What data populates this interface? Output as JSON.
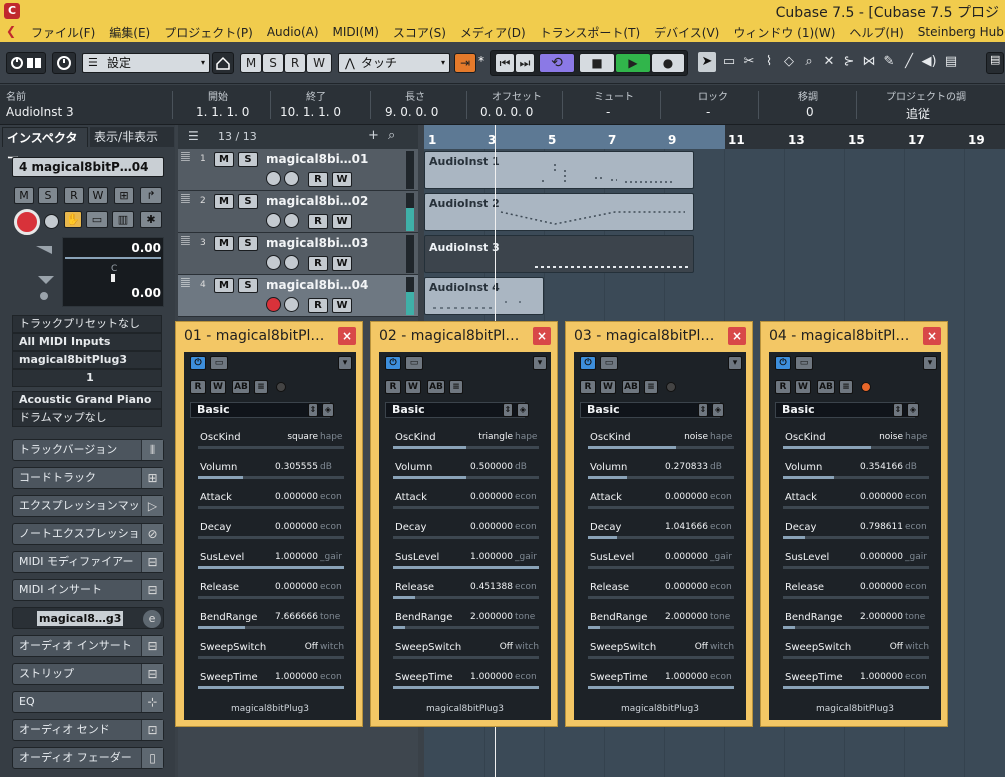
{
  "window": {
    "title": "Cubase 7.5 - [Cubase 7.5 プロジ",
    "app_icon": "cubase-logo-icon"
  },
  "menu": {
    "edit_icon": "e",
    "items": [
      "ファイル(F)",
      "編集(E)",
      "プロジェクト(P)",
      "Audio(A)",
      "MIDI(M)",
      "スコア(S)",
      "メディア(D)",
      "トランスポート(T)",
      "デバイス(V)",
      "ウィンドウ (1)(W)",
      "ヘルプ(H)",
      "Steinberg Hub(I)"
    ]
  },
  "toolbar": {
    "preset_label": "設定",
    "m": "M",
    "s": "S",
    "r": "R",
    "w": "W",
    "automation_mode": "タッチ",
    "auto_star": "*",
    "play_color": "#31b54b",
    "cycle_color": "#8b79e6"
  },
  "infoline": {
    "headers": {
      "name": "名前",
      "start": "開始",
      "end": "終了",
      "length": "長さ",
      "offset": "オフセット",
      "mute": "ミュート",
      "lock": "ロック",
      "transpose": "移調",
      "project_follow": "プロジェクトの調"
    },
    "values": {
      "name": "AudioInst",
      "name_num": "3",
      "start": "1.  1.  1.    0",
      "end": "10.  1.  1.    0",
      "length": "9.  0.  0.    0",
      "offset": "0.  0.  0.    0",
      "mute": "-",
      "lock": "-",
      "transpose": "0",
      "project_follow": "追従"
    }
  },
  "inspector": {
    "tab_inspector": "インスペクター",
    "tab_visibility": "表示/非表示",
    "track_num": "4",
    "track_name": "magical8bitP…04",
    "btn_m": "M",
    "btn_s": "S",
    "btn_r": "R",
    "btn_w": "W",
    "volume": "0.00",
    "pan_label": "C",
    "delay": "0.00",
    "preset": "トラックプリセットなし",
    "input": "All MIDI Inputs",
    "output": "magical8bitPlug3",
    "channel": "1",
    "program": "Acoustic Grand Piano",
    "drum_map": "ドラムマップなし",
    "sections": [
      "トラックバージョン",
      "コードトラック",
      "エクスプレッションマップ",
      "ノートエクスプレッション",
      "MIDI モディファイアー",
      "MIDI インサート"
    ],
    "insert_slot": "magical8…g3",
    "sections2": [
      "オーディオ インサート",
      "ストリップ",
      "EQ",
      "オーディオ センド",
      "オーディオ フェーダー"
    ]
  },
  "tracklist": {
    "counter": "13 / 13",
    "tracks": [
      {
        "num": "1",
        "name": "magical8bi…01",
        "m": "M",
        "s": "S",
        "r": "R",
        "w": "W"
      },
      {
        "num": "2",
        "name": "magical8bi…02",
        "m": "M",
        "s": "S",
        "r": "R",
        "w": "W"
      },
      {
        "num": "3",
        "name": "magical8bi…03",
        "m": "M",
        "s": "S",
        "r": "R",
        "w": "W"
      },
      {
        "num": "4",
        "name": "magical8bi…04",
        "m": "M",
        "s": "S",
        "r": "R",
        "w": "W"
      }
    ]
  },
  "ruler": {
    "bars": [
      "1",
      "3",
      "5",
      "7",
      "9",
      "11",
      "13",
      "15",
      "17",
      "19"
    ]
  },
  "events": [
    {
      "name": "AudioInst",
      "num": "1"
    },
    {
      "name": "AudioInst",
      "num": "2"
    },
    {
      "name": "AudioInst",
      "num": "3"
    },
    {
      "name": "AudioInst",
      "num": "4"
    }
  ],
  "plugins": [
    {
      "title": "01 - magical8bitPl…",
      "preset": "Basic",
      "footer": "magical8bitPlug3",
      "params": [
        {
          "label": "OscKind",
          "value": "square",
          "unit": "hape",
          "level": 0.0
        },
        {
          "label": "Volumn",
          "value": "0.305555",
          "unit": "dB",
          "level": 0.31
        },
        {
          "label": "Attack",
          "value": "0.000000",
          "unit": "econ",
          "level": 0.0
        },
        {
          "label": "Decay",
          "value": "0.000000",
          "unit": "econ",
          "level": 0.0
        },
        {
          "label": "SusLevel",
          "value": "1.000000",
          "unit": "_gair",
          "level": 1.0
        },
        {
          "label": "Release",
          "value": "0.000000",
          "unit": "econ",
          "level": 0.0
        },
        {
          "label": "BendRange",
          "value": "7.666666",
          "unit": "tone",
          "level": 0.32
        },
        {
          "label": "SweepSwitch",
          "value": "Off",
          "unit": "witch",
          "level": 0.0
        },
        {
          "label": "SweepTime",
          "value": "1.000000",
          "unit": "econ",
          "level": 1.0
        }
      ]
    },
    {
      "title": "02 - magical8bitPl…",
      "preset": "Basic",
      "footer": "magical8bitPlug3",
      "params": [
        {
          "label": "OscKind",
          "value": "triangle",
          "unit": "hape",
          "level": 0.5
        },
        {
          "label": "Volumn",
          "value": "0.500000",
          "unit": "dB",
          "level": 0.5
        },
        {
          "label": "Attack",
          "value": "0.000000",
          "unit": "econ",
          "level": 0.0
        },
        {
          "label": "Decay",
          "value": "0.000000",
          "unit": "econ",
          "level": 0.0
        },
        {
          "label": "SusLevel",
          "value": "1.000000",
          "unit": "_gair",
          "level": 1.0
        },
        {
          "label": "Release",
          "value": "0.451388",
          "unit": "econ",
          "level": 0.15
        },
        {
          "label": "BendRange",
          "value": "2.000000",
          "unit": "tone",
          "level": 0.08
        },
        {
          "label": "SweepSwitch",
          "value": "Off",
          "unit": "witch",
          "level": 0.0
        },
        {
          "label": "SweepTime",
          "value": "1.000000",
          "unit": "econ",
          "level": 1.0
        }
      ]
    },
    {
      "title": "03 - magical8bitPl…",
      "preset": "Basic",
      "footer": "magical8bitPlug3",
      "params": [
        {
          "label": "OscKind",
          "value": "noise",
          "unit": "hape",
          "level": 0.6
        },
        {
          "label": "Volumn",
          "value": "0.270833",
          "unit": "dB",
          "level": 0.27
        },
        {
          "label": "Attack",
          "value": "0.000000",
          "unit": "econ",
          "level": 0.0
        },
        {
          "label": "Decay",
          "value": "1.041666",
          "unit": "econ",
          "level": 0.2
        },
        {
          "label": "SusLevel",
          "value": "0.000000",
          "unit": "_gair",
          "level": 0.0
        },
        {
          "label": "Release",
          "value": "0.000000",
          "unit": "econ",
          "level": 0.0
        },
        {
          "label": "BendRange",
          "value": "2.000000",
          "unit": "tone",
          "level": 0.08
        },
        {
          "label": "SweepSwitch",
          "value": "Off",
          "unit": "witch",
          "level": 0.0
        },
        {
          "label": "SweepTime",
          "value": "1.000000",
          "unit": "econ",
          "level": 1.0
        }
      ]
    },
    {
      "title": "04 - magical8bitPl…",
      "preset": "Basic",
      "footer": "magical8bitPlug3",
      "params": [
        {
          "label": "OscKind",
          "value": "noise",
          "unit": "hape",
          "level": 0.6
        },
        {
          "label": "Volumn",
          "value": "0.354166",
          "unit": "dB",
          "level": 0.35
        },
        {
          "label": "Attack",
          "value": "0.000000",
          "unit": "econ",
          "level": 0.0
        },
        {
          "label": "Decay",
          "value": "0.798611",
          "unit": "econ",
          "level": 0.15
        },
        {
          "label": "SusLevel",
          "value": "0.000000",
          "unit": "_gair",
          "level": 0.0
        },
        {
          "label": "Release",
          "value": "0.000000",
          "unit": "econ",
          "level": 0.0
        },
        {
          "label": "BendRange",
          "value": "2.000000",
          "unit": "tone",
          "level": 0.08
        },
        {
          "label": "SweepSwitch",
          "value": "Off",
          "unit": "witch",
          "level": 0.0
        },
        {
          "label": "SweepTime",
          "value": "1.000000",
          "unit": "econ",
          "level": 1.0
        }
      ]
    }
  ]
}
